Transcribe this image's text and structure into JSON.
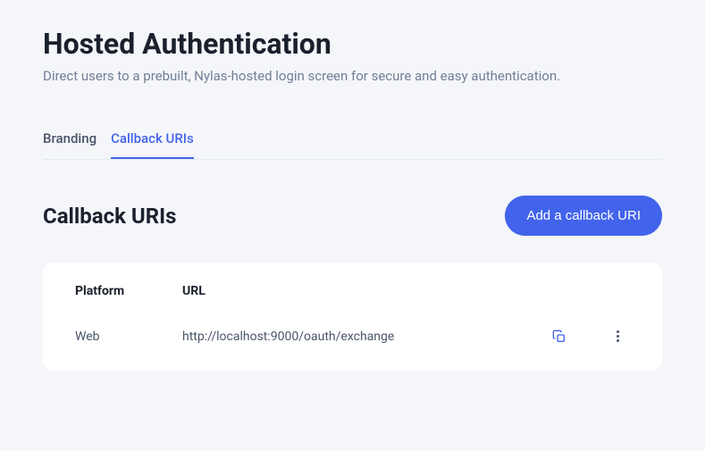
{
  "header": {
    "title": "Hosted Authentication",
    "subtitle": "Direct users to a prebuilt, Nylas-hosted login screen for secure and easy authentication."
  },
  "tabs": {
    "branding": "Branding",
    "callback_uris": "Callback URIs"
  },
  "section": {
    "title": "Callback URIs",
    "add_button": "Add a callback URI"
  },
  "table": {
    "headers": {
      "platform": "Platform",
      "url": "URL"
    },
    "rows": [
      {
        "platform": "Web",
        "url": "http://localhost:9000/oauth/exchange"
      }
    ]
  }
}
